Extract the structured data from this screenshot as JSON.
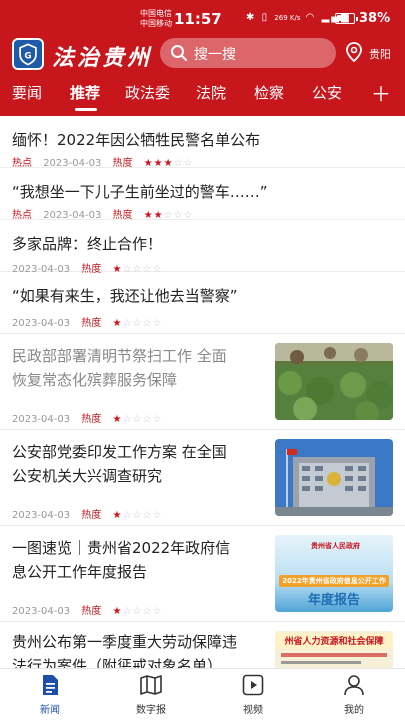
{
  "status": {
    "carrier_1": "中国电信",
    "carrier_2": "中国移动",
    "time": "11:57",
    "net_speed": "269 K/s",
    "battery": "38%"
  },
  "header": {
    "app_name": "法治贵州",
    "search_placeholder": "搜一搜",
    "location": "贵阳"
  },
  "tabs": [
    "要闻",
    "推荐",
    "政法委",
    "法院",
    "检察",
    "公安"
  ],
  "active_tab": "推荐",
  "feed": [
    {
      "title": "缅怀！2022年因公牺牲民警名单公布",
      "tag": "热点",
      "date": "2023-04-03",
      "heat_label": "热度",
      "heat": 3
    },
    {
      "title": "“我想坐一下儿子生前坐过的警车……”",
      "tag": "热点",
      "date": "2023-04-03",
      "heat_label": "热度",
      "heat": 2
    },
    {
      "title": "多家品牌：终止合作！",
      "date": "2023-04-03",
      "heat_label": "热度",
      "heat": 1
    },
    {
      "title": "“如果有来生，我还让他去当警察”",
      "date": "2023-04-03",
      "heat_label": "热度",
      "heat": 1
    },
    {
      "title_line1": "民政部部署清明节祭扫工作 全面",
      "title_line2": "恢复常态化殡葬服务保障",
      "date": "2023-04-03",
      "heat_label": "热度",
      "heat": 1,
      "thumb": "cemetery-photo"
    },
    {
      "title_line1": "公安部党委印发工作方案 在全国",
      "title_line2": "公安机关大兴调查研究",
      "date": "2023-04-03",
      "heat_label": "热度",
      "heat": 1,
      "thumb": "building-photo"
    },
    {
      "title_line1": "一图速览｜贵州省2022年政府信",
      "title_line2": "息公开工作年度报告",
      "date": "2023-04-03",
      "heat_label": "热度",
      "heat": 1,
      "thumb": "report-graphic"
    },
    {
      "title_line1": "贵州公布第一季度重大劳动保障违",
      "title_line2": "法行为案件（附惩戒对象名单）",
      "thumb": "labor-banner"
    }
  ],
  "thumb_text": {
    "report_org": "贵州省人民政府",
    "report_year": "2022年贵州省政府信息公开工作",
    "report_title": "年度报告",
    "labor_title": "州省人力资源和社会保障"
  },
  "bottom_nav": [
    "新闻",
    "数字报",
    "视频",
    "我的"
  ],
  "colors": {
    "brand_red": "#c8161d",
    "nav_blue": "#1e4fa8"
  },
  "icons": [
    "search-icon",
    "location-pin-icon",
    "plus-icon",
    "news-document-icon",
    "map-newspaper-icon",
    "video-play-icon",
    "user-profile-icon"
  ]
}
